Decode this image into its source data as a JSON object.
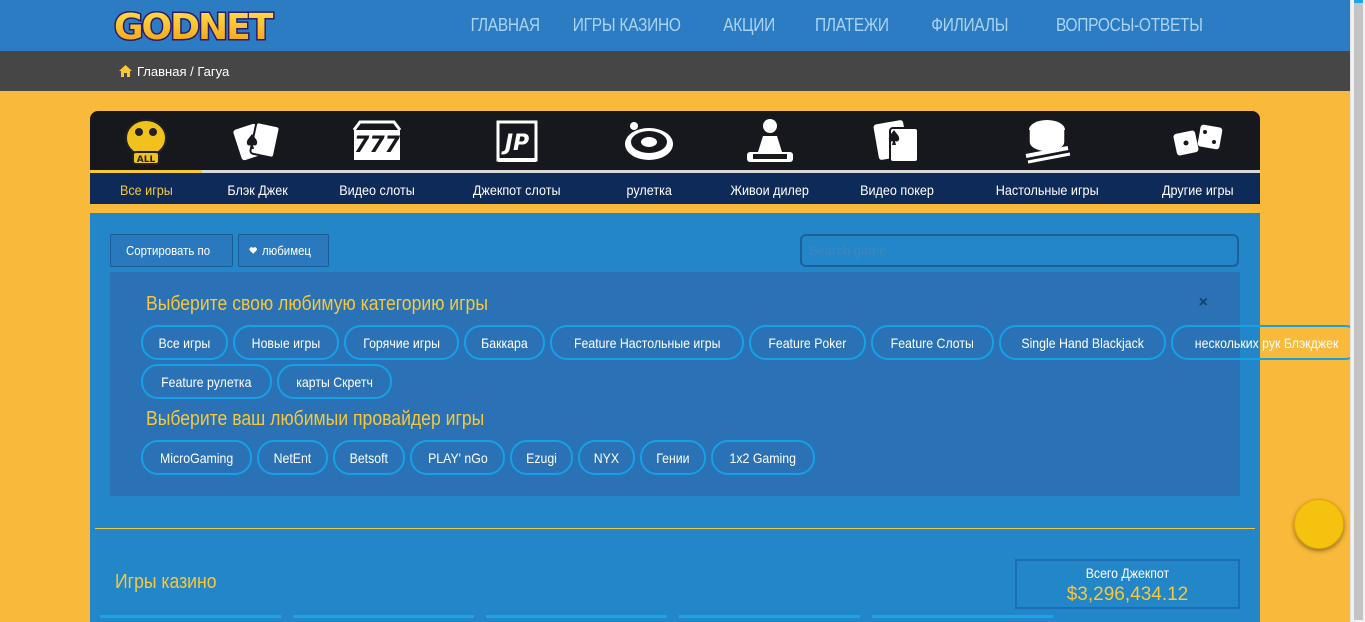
{
  "nav": {
    "logo": "GODNET",
    "items": [
      "ГЛАВНАЯ",
      "ИГРЫ КАЗИНО",
      "АКЦИИ",
      "ПЛАТЕЖИ",
      "ФИЛИАЛЫ",
      "ВОПРОСЫ-ОТВЕТЫ"
    ]
  },
  "breadcrumb": {
    "text": "Главная / Гагуа"
  },
  "categories": [
    {
      "label": "Все игры",
      "icon": "all-games-icon",
      "active": true
    },
    {
      "label": "Блэк Джек",
      "icon": "cards-icon"
    },
    {
      "label": "Видео слоты",
      "icon": "slot-777-icon"
    },
    {
      "label": "Джекпот слоты",
      "icon": "jackpot-jp-icon"
    },
    {
      "label": "рулетка",
      "icon": "roulette-icon"
    },
    {
      "label": "Живои дилер",
      "icon": "live-dealer-icon"
    },
    {
      "label": "Видео покер",
      "icon": "video-poker-icon"
    },
    {
      "label": "Настольные игры",
      "icon": "table-games-icon"
    },
    {
      "label": "Другие игры",
      "icon": "dice-icon"
    }
  ],
  "toolbar": {
    "sort_label": "Сортировать по",
    "fav_label": "любимец",
    "search_placeholder": "Search game"
  },
  "filters": {
    "category_title": "Выберите свою любимую категорию игры",
    "categories_row1": [
      "Все игры",
      "Новые игры",
      "Горячие игры",
      "Баккара",
      "Feature Настольные игры",
      "Feature Poker",
      "Feature Слоты",
      "Single Hand Blackjack",
      "нескольких рук Блэкджек"
    ],
    "categories_row2": [
      "Feature рулетка",
      "карты Скретч"
    ],
    "provider_title": "Выберите ваш любимыи провайдер игры",
    "providers": [
      "MicroGaming",
      "NetEnt",
      "Betsoft",
      "PLAY' nGo",
      "Ezugi",
      "NYX",
      "Гении",
      "1x2 Gaming"
    ],
    "close": "×"
  },
  "section": {
    "title": "Игры казино",
    "jackpot_label": "Всего Джекпот",
    "jackpot_value": "$3,296,434.12"
  },
  "colors": {
    "accent": "#f6c83a",
    "nav_bg": "#2c7cc3",
    "panel_bg": "#2386c8",
    "page_bg": "#f9b93a"
  }
}
